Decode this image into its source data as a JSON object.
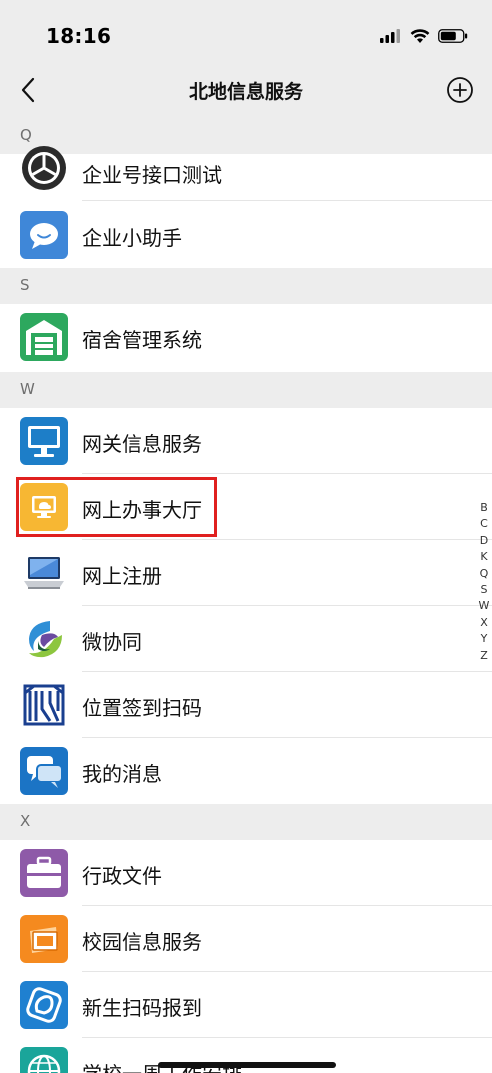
{
  "status_bar": {
    "time": "18:16"
  },
  "nav": {
    "title": "北地信息服务"
  },
  "sections": {
    "q": "Q",
    "s": "S",
    "w": "W",
    "x": "X"
  },
  "items": {
    "qiyehao": "企业号接口测试",
    "xiaozhushou": "企业小助手",
    "sushe": "宿舍管理系统",
    "wangguan": "网关信息服务",
    "banshidating": "网上办事大厅",
    "zhuce": "网上注册",
    "xietong": "微协同",
    "qiandao": "位置签到扫码",
    "xiaoxi": "我的消息",
    "xingzheng": "行政文件",
    "xiaoyuan": "校园信息服务",
    "xinsheng": "新生扫码报到",
    "zhouanpai": "学校一周工作安排"
  },
  "index_letters": [
    "B",
    "C",
    "D",
    "K",
    "Q",
    "S",
    "W",
    "X",
    "Y",
    "Z"
  ],
  "colors": {
    "highlight": "#e0201f",
    "header_bg": "#ededed"
  }
}
